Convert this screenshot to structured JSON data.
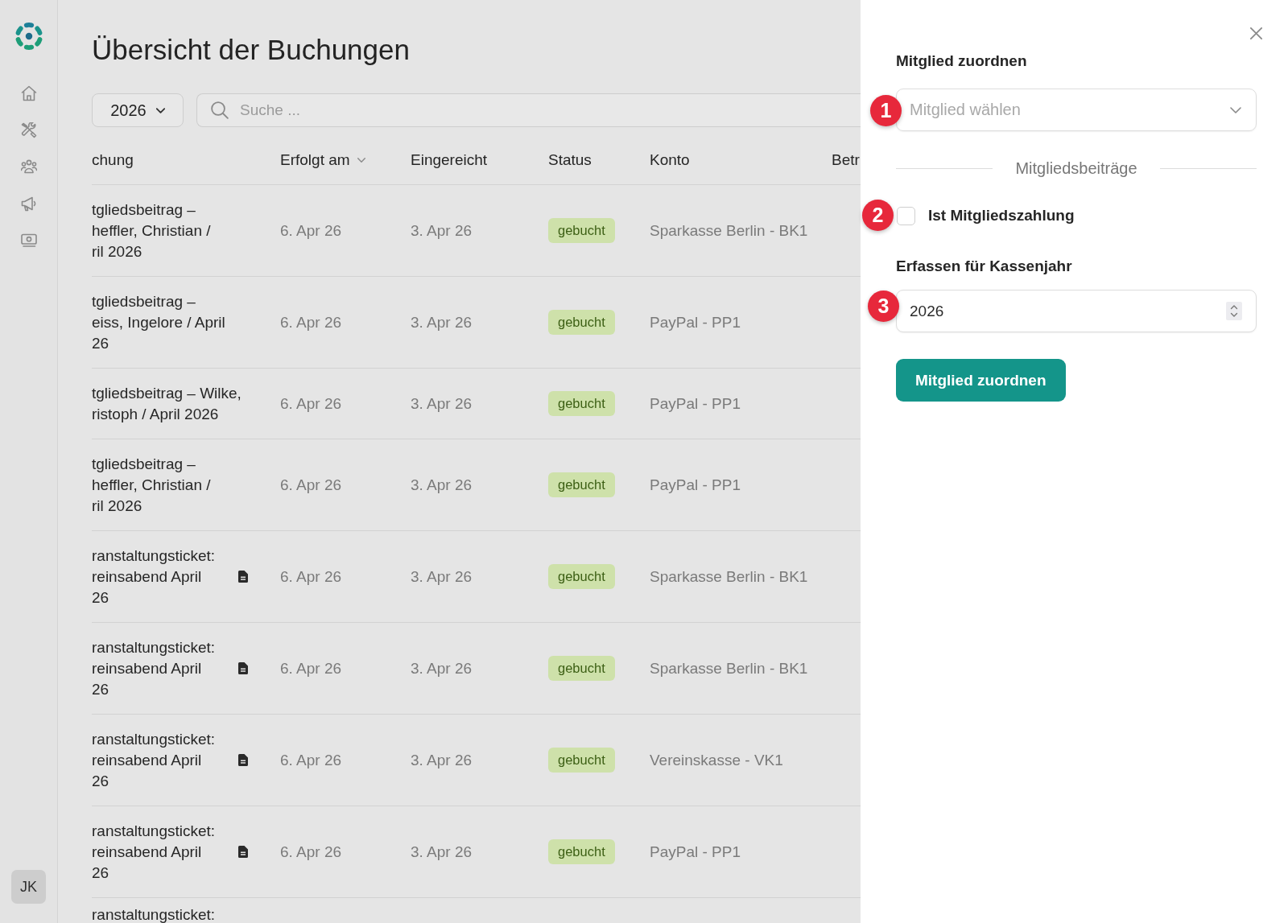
{
  "sidebar": {
    "avatar": "JK"
  },
  "page": {
    "title": "Übersicht der Buchungen"
  },
  "filters": {
    "year_select": {
      "value": "2026"
    },
    "search": {
      "placeholder": "Suche ..."
    }
  },
  "table": {
    "columns": [
      {
        "label": "chung",
        "sorted": false
      },
      {
        "label": "Erfolgt am",
        "sorted": true
      },
      {
        "label": "Eingereicht",
        "sorted": false
      },
      {
        "label": "Status",
        "sorted": false
      },
      {
        "label": "Konto",
        "sorted": false
      },
      {
        "label": "Betr",
        "sorted": false
      }
    ],
    "rows": [
      {
        "booking": [
          "tgliedsbeitrag –",
          "heffler, Christian /",
          "ril 2026"
        ],
        "attachment": false,
        "booked_on": "6. Apr 26",
        "submitted_on": "3. Apr 26",
        "status": "gebucht",
        "account": "Sparkasse Berlin - BK1"
      },
      {
        "booking": [
          "tgliedsbeitrag –",
          "eiss, Ingelore / April",
          "26"
        ],
        "attachment": false,
        "booked_on": "6. Apr 26",
        "submitted_on": "3. Apr 26",
        "status": "gebucht",
        "account": "PayPal - PP1"
      },
      {
        "booking": [
          "tgliedsbeitrag – Wilke,",
          "ristoph / April 2026"
        ],
        "attachment": false,
        "booked_on": "6. Apr 26",
        "submitted_on": "3. Apr 26",
        "status": "gebucht",
        "account": "PayPal - PP1"
      },
      {
        "booking": [
          "tgliedsbeitrag –",
          "heffler, Christian /",
          "ril 2026"
        ],
        "attachment": false,
        "booked_on": "6. Apr 26",
        "submitted_on": "3. Apr 26",
        "status": "gebucht",
        "account": "PayPal - PP1"
      },
      {
        "booking": [
          "ranstaltungsticket:",
          "reinsabend April",
          "26"
        ],
        "attachment": true,
        "booked_on": "6. Apr 26",
        "submitted_on": "3. Apr 26",
        "status": "gebucht",
        "account": "Sparkasse Berlin - BK1"
      },
      {
        "booking": [
          "ranstaltungsticket:",
          "reinsabend April",
          "26"
        ],
        "attachment": true,
        "booked_on": "6. Apr 26",
        "submitted_on": "3. Apr 26",
        "status": "gebucht",
        "account": "Sparkasse Berlin - BK1"
      },
      {
        "booking": [
          "ranstaltungsticket:",
          "reinsabend April",
          "26"
        ],
        "attachment": true,
        "booked_on": "6. Apr 26",
        "submitted_on": "3. Apr 26",
        "status": "gebucht",
        "account": "Vereinskasse - VK1"
      },
      {
        "booking": [
          "ranstaltungsticket:",
          "reinsabend April",
          "26"
        ],
        "attachment": true,
        "booked_on": "6. Apr 26",
        "submitted_on": "3. Apr 26",
        "status": "gebucht",
        "account": "PayPal - PP1"
      },
      {
        "booking": [
          "ranstaltungsticket:"
        ],
        "attachment": false
      }
    ]
  },
  "panel": {
    "heading": "Mitglied zuordnen",
    "member_select": {
      "placeholder": "Mitglied wählen",
      "marker": "1"
    },
    "section_title": "Mitgliedsbeiträge",
    "member_checkbox": {
      "label": "Ist Mitgliedszahlung",
      "checked": false,
      "marker": "2"
    },
    "year_label": "Erfassen für Kassenjahr",
    "year_input": {
      "value": "2026",
      "marker": "3"
    },
    "submit_button": "Mitglied zuordnen"
  }
}
